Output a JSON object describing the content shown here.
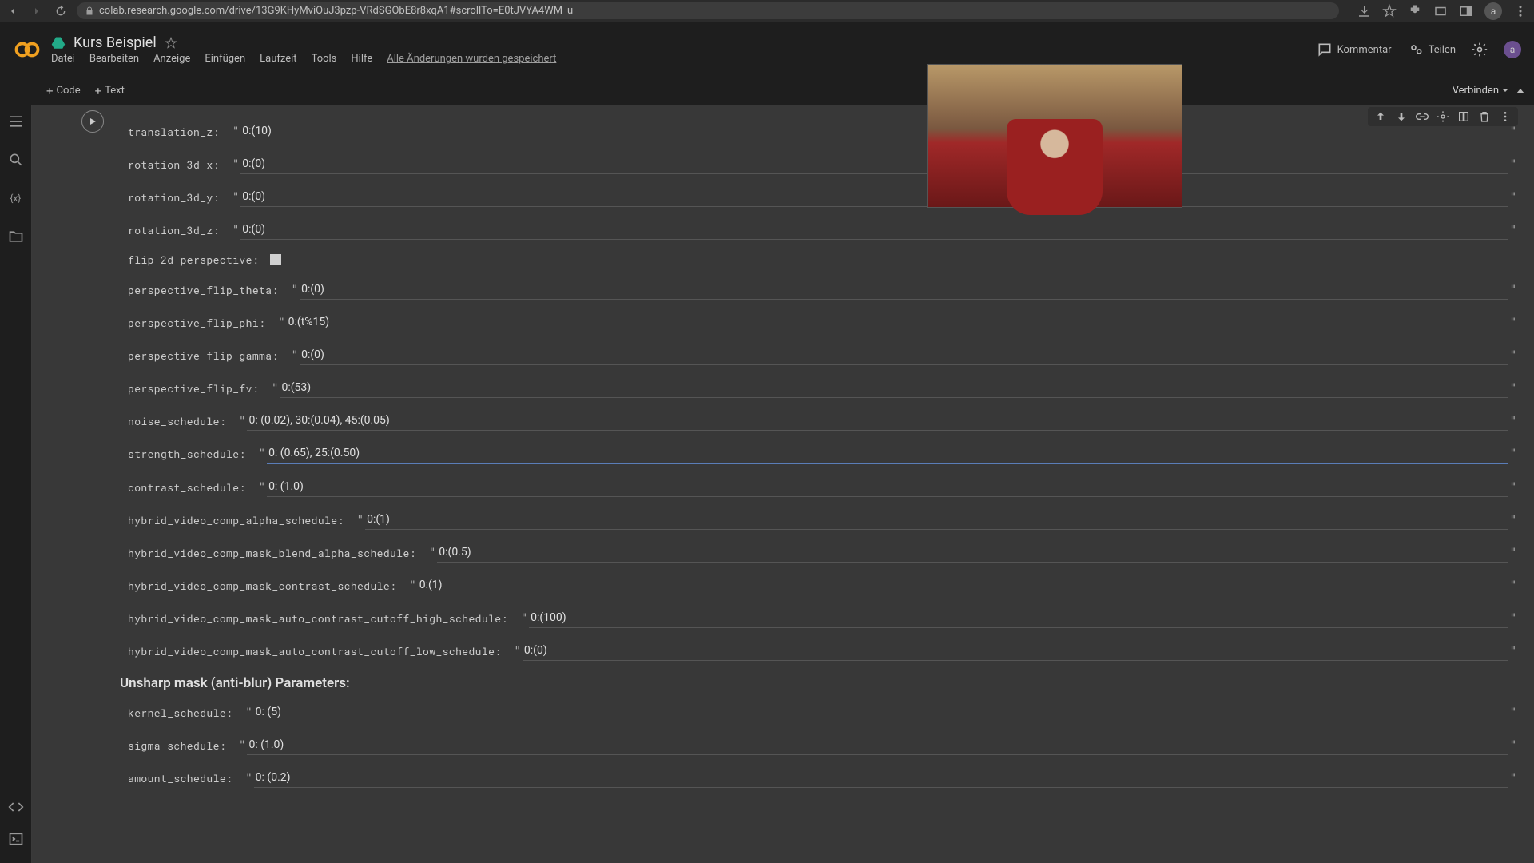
{
  "browser": {
    "url": "colab.research.google.com/drive/13G9KHyMviOuJ3pzp-VRdSGObE8r8xqA1#scrollTo=E0tJVYA4WM_u",
    "avatar": "a"
  },
  "header": {
    "title": "Kurs Beispiel",
    "menu": [
      "Datei",
      "Bearbeiten",
      "Anzeige",
      "Einfügen",
      "Laufzeit",
      "Tools",
      "Hilfe"
    ],
    "saved_status": "Alle Änderungen wurden gespeichert",
    "comment": "Kommentar",
    "share": "Teilen",
    "avatar": "a"
  },
  "toolbar": {
    "code_label": "Code",
    "text_label": "Text",
    "connect_label": "Verbinden"
  },
  "form": {
    "fields": [
      {
        "name": "translation_z:",
        "value": "0:(10)"
      },
      {
        "name": "rotation_3d_x:",
        "value": "0:(0)"
      },
      {
        "name": "rotation_3d_y:",
        "value": "0:(0)"
      },
      {
        "name": "rotation_3d_z:",
        "value": "0:(0)"
      },
      {
        "name": "flip_2d_perspective:",
        "checkbox": true
      },
      {
        "name": "perspective_flip_theta:",
        "value": "0:(0)"
      },
      {
        "name": "perspective_flip_phi:",
        "value": "0:(t%15)"
      },
      {
        "name": "perspective_flip_gamma:",
        "value": "0:(0)"
      },
      {
        "name": "perspective_flip_fv:",
        "value": "0:(53)"
      },
      {
        "name": "noise_schedule:",
        "value": "0: (0.02), 30:(0.04), 45:(0.05)"
      },
      {
        "name": "strength_schedule:",
        "value": "0: (0.65), 25:(0.50)",
        "active": true
      },
      {
        "name": "contrast_schedule:",
        "value": "0: (1.0)"
      },
      {
        "name": "hybrid_video_comp_alpha_schedule:",
        "value": "0:(1)"
      },
      {
        "name": "hybrid_video_comp_mask_blend_alpha_schedule:",
        "value": "0:(0.5)"
      },
      {
        "name": "hybrid_video_comp_mask_contrast_schedule:",
        "value": "0:(1)"
      },
      {
        "name": "hybrid_video_comp_mask_auto_contrast_cutoff_high_schedule:",
        "value": "0:(100)"
      },
      {
        "name": "hybrid_video_comp_mask_auto_contrast_cutoff_low_schedule:",
        "value": "0:(0)"
      }
    ],
    "section_title": "Unsharp mask (anti-blur) Parameters:",
    "fields2": [
      {
        "name": "kernel_schedule:",
        "value": "0: (5)"
      },
      {
        "name": "sigma_schedule:",
        "value": "0: (1.0)"
      },
      {
        "name": "amount_schedule:",
        "value": "0: (0.2)"
      }
    ]
  }
}
